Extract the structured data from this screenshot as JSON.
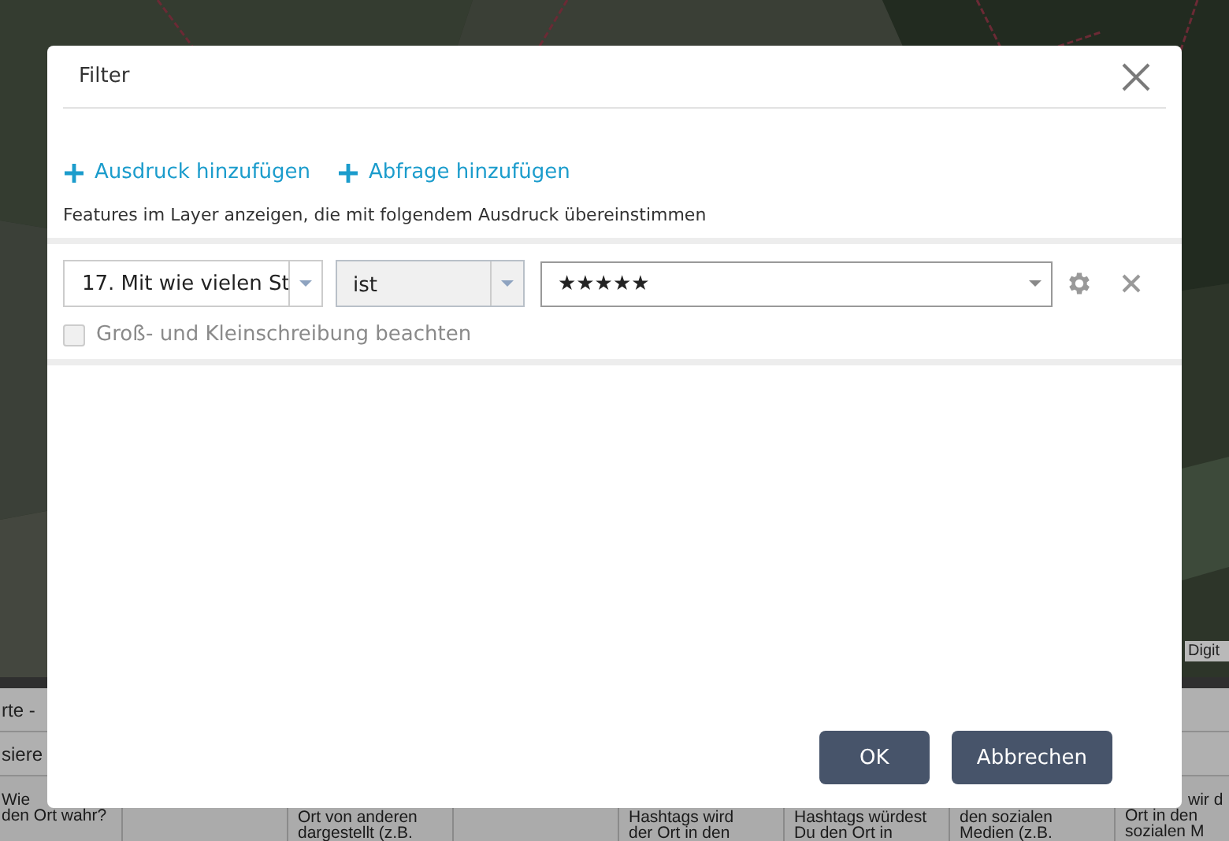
{
  "map": {
    "kind": "picture",
    "attribution": "Digit"
  },
  "table": {
    "title": "rte -",
    "toolbar_item": "siere",
    "cells": [
      {
        "lines": [
          "Wie",
          "den Ort wahr?"
        ]
      },
      {},
      {
        "lines": [
          "Ort von anderen",
          "dargestellt (z.B."
        ]
      },
      {},
      {
        "lines": [
          "Hashtags wird",
          "der Ort in den"
        ]
      },
      {
        "lines": [
          "Hashtags würdest",
          "Du den Ort in"
        ]
      },
      {
        "lines": [
          "den sozialen",
          "Medien (z.B."
        ]
      },
      {
        "lines": [
          "wir d",
          "Ort in den",
          "sozialen M"
        ]
      }
    ]
  },
  "dialog": {
    "title": "Filter",
    "links": [
      "Ausdruck hinzufügen",
      "Abfrage hinzufügen"
    ],
    "description": "Features im Layer anzeigen, die mit folgendem Ausdruck übereinstimmen",
    "expression": {
      "field": "17. Mit wie vielen St",
      "operator": "ist",
      "value": "★★★★★",
      "case_sensitive": {
        "label": "Groß- und Kleinschreibung beachten",
        "checked": false,
        "disabled": true
      }
    },
    "buttons": [
      "OK",
      "Abbrechen"
    ]
  }
}
